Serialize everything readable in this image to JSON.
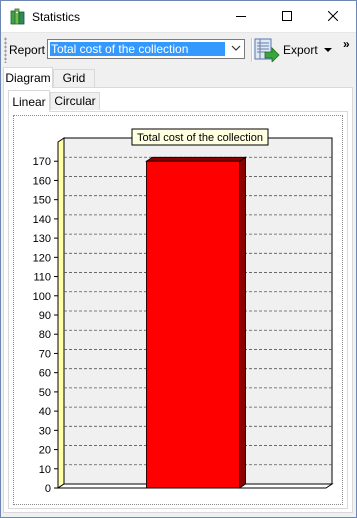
{
  "window": {
    "title": "Statistics",
    "icon": "books-icon",
    "controls": [
      "minimize-icon",
      "maximize-icon",
      "close-icon"
    ]
  },
  "toolbar": {
    "report_label": "Report",
    "report_value": "Total cost of the collection",
    "export_label": "Export",
    "export_icon": "export-icon",
    "overflow": "»"
  },
  "tabs": [
    {
      "label": "Diagram",
      "active": true
    },
    {
      "label": "Grid",
      "active": false
    }
  ],
  "subtabs": [
    {
      "label": "Linear",
      "active": true
    },
    {
      "label": "Circular",
      "active": false
    }
  ],
  "chart_data": {
    "type": "bar",
    "title": "Total cost of the collection",
    "categories": [
      ""
    ],
    "values": [
      170
    ],
    "ylim": [
      0,
      180
    ],
    "yticks": [
      0,
      10,
      20,
      30,
      40,
      50,
      60,
      70,
      80,
      90,
      100,
      110,
      120,
      130,
      140,
      150,
      160,
      170
    ],
    "xlabel": "",
    "ylabel": "",
    "grid": true,
    "three_d": true,
    "colors": {
      "bar": "#ff0000",
      "bar_side": "#8b0000",
      "wall": "#f0f0f0",
      "left_wall": "#ffffa8",
      "grid": "#555555"
    }
  }
}
